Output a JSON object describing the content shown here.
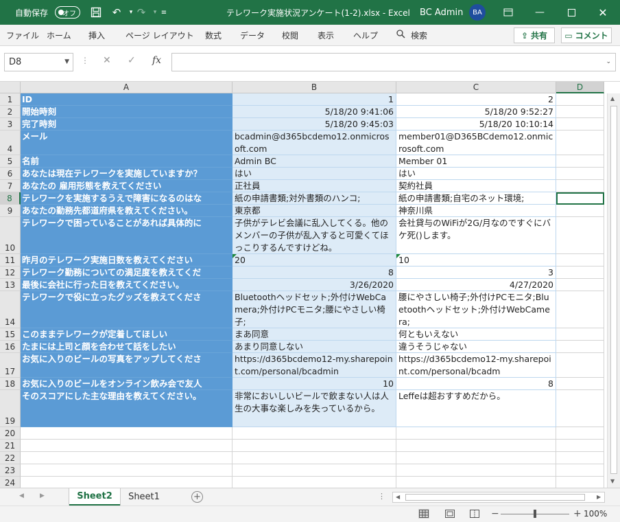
{
  "titlebar": {
    "autosave_label": "自動保存",
    "autosave_state": "オフ",
    "title": "テレワーク実施状況アンケート(1-2).xlsx  -  Excel",
    "user_name": "BC Admin",
    "user_initials": "BA",
    "colors": {
      "background": "#217346"
    }
  },
  "ribbon": {
    "menus": [
      "ファイル",
      "ホーム",
      "挿入",
      "ページ レイアウト",
      "数式",
      "データ",
      "校閲",
      "表示",
      "ヘルプ",
      "検索"
    ],
    "share_label": "共有",
    "comment_label": "コメント"
  },
  "formula_bar": {
    "name_box": "D8",
    "formula": ""
  },
  "grid": {
    "columns": [
      "A",
      "B",
      "C",
      "D"
    ],
    "selected_column": "D",
    "selected_row": "8",
    "rows": [
      {
        "n": "1",
        "a": "ID",
        "b": "1",
        "c": "2"
      },
      {
        "n": "2",
        "a": "開始時刻",
        "b": "5/18/20 9:41:06",
        "c": "5/18/20 9:52:27"
      },
      {
        "n": "3",
        "a": "完了時刻",
        "b": "5/18/20 9:45:03",
        "c": "5/18/20 10:10:14"
      },
      {
        "n": "4",
        "a": "メール",
        "b": "bcadmin@d365bcdemo12.onmicrosoft.com",
        "c": "member01@D365BCdemo12.onmicrosoft.com"
      },
      {
        "n": "5",
        "a": "名前",
        "b": "Admin BC",
        "c": "Member 01"
      },
      {
        "n": "6",
        "a": "あなたは現在テレワークを実施していますか？",
        "b": "はい",
        "c": "はい"
      },
      {
        "n": "7",
        "a": "あなたの 雇用形態を教えてください",
        "b": "正社員",
        "c": "契約社員"
      },
      {
        "n": "8",
        "a": "テレワークを実施するうえで障害になるのはな",
        "b": "紙の申請書類;対外書類のハンコ;",
        "c": "紙の申請書類;自宅のネット環境;"
      },
      {
        "n": "9",
        "a": "あなたの勤務先都道府県を教えてください。",
        "b": "東京都",
        "c": "神奈川県"
      },
      {
        "n": "10",
        "a": "テレワークで困っていることがあれば具体的に",
        "b": "子供がテレビ会議に乱入してくる。他のメンバーの子供が乱入すると可愛くてほっこりするんですけどね。",
        "c": "会社貸与のWiFiが2G/月なのですぐにバケ死()します。"
      },
      {
        "n": "11",
        "a": "昨月のテレワーク実施日数を教えてください",
        "b": "20",
        "c": "10"
      },
      {
        "n": "12",
        "a": "テレワーク勤務についての満足度を教えてくだ",
        "b": "8",
        "c": "3"
      },
      {
        "n": "13",
        "a": "最後に会社に行った日を教えてください。",
        "b": "3/26/2020",
        "c": "4/27/2020"
      },
      {
        "n": "14",
        "a": "テレワークで役に立ったグッズを教えてくださ",
        "b": "Bluetoothヘッドセット;外付けWebCamera;外付けPCモニタ;腰にやさしい椅子;",
        "c": "腰にやさしい椅子;外付けPCモニタ;Bluetoothヘッドセット;外付けWebCamera;"
      },
      {
        "n": "15",
        "a": "このままテレワークが定着してほしい",
        "b": "まあ同意",
        "c": "何ともいえない"
      },
      {
        "n": "16",
        "a": "たまには上司と顔を合わせて話をしたい",
        "b": "あまり同意しない",
        "c": "違うそうじゃない"
      },
      {
        "n": "17",
        "a": "お気に入りのビールの写真をアップしてくださ",
        "b": "https://d365bcdemo12-my.sharepoint.com/personal/bcadmin",
        "c": "https://d365bcdemo12-my.sharepoint.com/personal/bcadm"
      },
      {
        "n": "18",
        "a": "お気に入りのビールをオンライン飲み会で友人",
        "b": "10",
        "c": "8"
      },
      {
        "n": "19",
        "a": "そのスコアにした主な理由を教えてください。",
        "b": "非常においしいビールで飲まない人は人生の大事な楽しみを失っているから。",
        "c": "Leffeは超おすすめだから。"
      },
      {
        "n": "20"
      },
      {
        "n": "21"
      },
      {
        "n": "22"
      },
      {
        "n": "23"
      },
      {
        "n": "24"
      }
    ]
  },
  "sheets": {
    "tabs": [
      "Sheet2",
      "Sheet1"
    ],
    "active": "Sheet2"
  },
  "statusbar": {
    "zoom": "100%",
    "zoom_fraction": 0.5
  },
  "icons": {
    "save": "save-icon",
    "undo": "undo-icon",
    "redo": "redo-icon",
    "search": "search-icon",
    "cancel": "cancel-icon",
    "enter": "check-icon",
    "function": "function-icon"
  }
}
